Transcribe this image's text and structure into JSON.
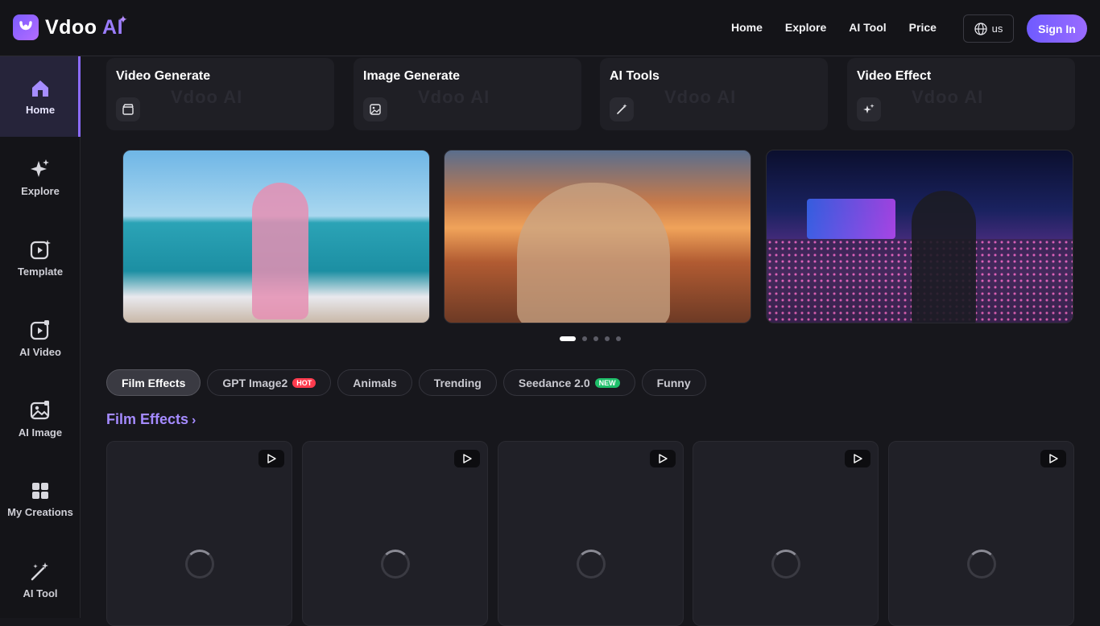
{
  "brand": {
    "name": "Vdoo",
    "ai": "AI"
  },
  "nav": [
    {
      "label": "Home"
    },
    {
      "label": "Explore"
    },
    {
      "label": "AI Tool"
    },
    {
      "label": "Price"
    }
  ],
  "lang": "us",
  "signin": "Sign In",
  "sidebar": [
    {
      "label": "Home",
      "icon": "home-icon"
    },
    {
      "label": "Explore",
      "icon": "sparkle-icon"
    },
    {
      "label": "Template",
      "icon": "template-icon"
    },
    {
      "label": "AI Video",
      "icon": "ai-video-icon"
    },
    {
      "label": "AI Image",
      "icon": "ai-image-icon"
    },
    {
      "label": "My Creations",
      "icon": "grid-icon"
    },
    {
      "label": "AI Tool",
      "icon": "magic-wand-icon"
    }
  ],
  "tools": [
    {
      "title": "Video Generate",
      "watermark": "Vdoo AI",
      "icon": "clapper-icon"
    },
    {
      "title": "Image Generate",
      "watermark": "Vdoo AI",
      "icon": "image-icon"
    },
    {
      "title": "AI Tools",
      "watermark": "Vdoo AI",
      "icon": "wand-icon"
    },
    {
      "title": "Video Effect",
      "watermark": "Vdoo AI",
      "icon": "effect-sparkle-icon"
    }
  ],
  "carousel": {
    "slides": 5,
    "active": 0
  },
  "chips": [
    {
      "label": "Film Effects",
      "badge": ""
    },
    {
      "label": "GPT Image2",
      "badge": "HOT"
    },
    {
      "label": "Animals",
      "badge": ""
    },
    {
      "label": "Trending",
      "badge": ""
    },
    {
      "label": "Seedance 2.0",
      "badge": "NEW"
    },
    {
      "label": "Funny",
      "badge": ""
    }
  ],
  "section": {
    "title": "Film Effects",
    "arrow": "›"
  },
  "colors": {
    "accent": "#8c6bff",
    "hot": "#ff3b4e",
    "new": "#1fbf6a"
  }
}
